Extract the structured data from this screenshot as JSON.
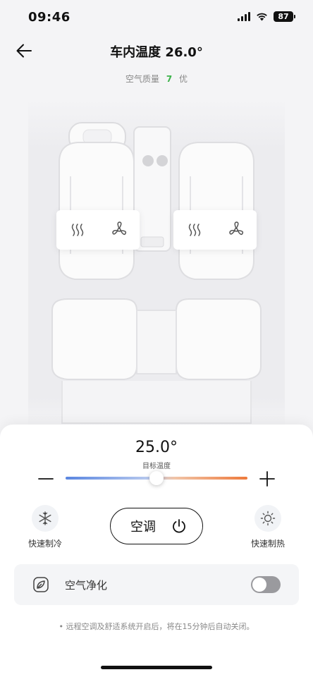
{
  "status_bar": {
    "time": "09:46",
    "battery": "87"
  },
  "header": {
    "title": "车内温度 26.0°"
  },
  "air_quality": {
    "label": "空气质量",
    "value": "7",
    "rating": "优",
    "value_color": "#3cb34a"
  },
  "seats": {
    "front_left": {
      "heat_icon": "seat-heat-icon",
      "fan_icon": "seat-ventilation-icon"
    },
    "front_right": {
      "heat_icon": "seat-heat-icon",
      "fan_icon": "seat-ventilation-icon"
    }
  },
  "climate": {
    "target_temp": "25.0°",
    "target_label": "目标温度",
    "slider_level": 0.5,
    "quick_cool_label": "快速制冷",
    "quick_heat_label": "快速制热",
    "ac_label": "空调",
    "slider_colors": {
      "cold": "#5a86e0",
      "hot": "#ee7a3c"
    }
  },
  "air_purify": {
    "label": "空气净化",
    "enabled": false
  },
  "footer": {
    "note": "• 远程空调及舒适系统开启后，将在15分钟后自动关闭。"
  }
}
